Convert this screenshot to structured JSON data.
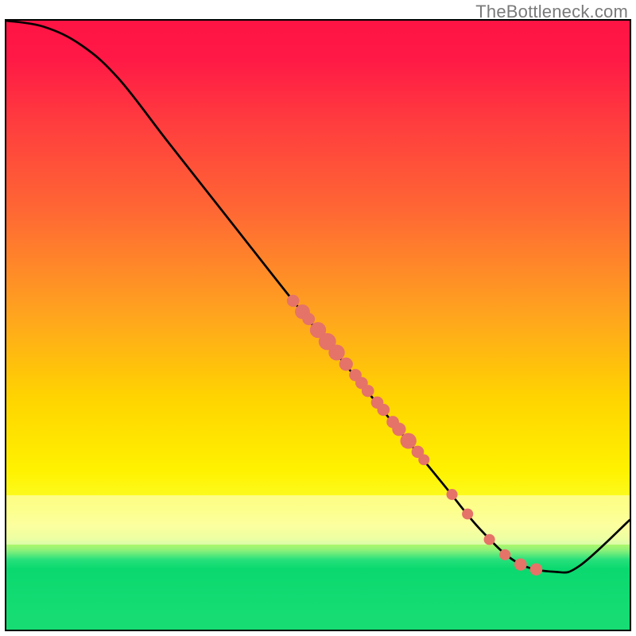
{
  "watermark": "TheBottleneck.com",
  "chart_data": {
    "type": "line",
    "title": "",
    "xlabel": "",
    "ylabel": "",
    "xlim": [
      0,
      100
    ],
    "ylim": [
      0,
      100
    ],
    "highlight_band_y": [
      14,
      22
    ],
    "curve": [
      {
        "x": 0,
        "y": 100
      },
      {
        "x": 6,
        "y": 99
      },
      {
        "x": 12,
        "y": 96
      },
      {
        "x": 18,
        "y": 90.5
      },
      {
        "x": 26,
        "y": 80
      },
      {
        "x": 36,
        "y": 67
      },
      {
        "x": 46,
        "y": 54
      },
      {
        "x": 54,
        "y": 44
      },
      {
        "x": 62,
        "y": 34
      },
      {
        "x": 70,
        "y": 24
      },
      {
        "x": 76,
        "y": 16.5
      },
      {
        "x": 82,
        "y": 11
      },
      {
        "x": 88,
        "y": 9.5
      },
      {
        "x": 92,
        "y": 10.5
      },
      {
        "x": 100,
        "y": 18
      }
    ],
    "markers": [
      {
        "x": 46,
        "y": 54,
        "r": 1.0
      },
      {
        "x": 47.5,
        "y": 52.2,
        "r": 1.2
      },
      {
        "x": 48.5,
        "y": 51.0,
        "r": 1.0
      },
      {
        "x": 50,
        "y": 49.2,
        "r": 1.3
      },
      {
        "x": 51.5,
        "y": 47.3,
        "r": 1.4
      },
      {
        "x": 53,
        "y": 45.5,
        "r": 1.3
      },
      {
        "x": 54.5,
        "y": 43.6,
        "r": 1.1
      },
      {
        "x": 56,
        "y": 41.8,
        "r": 1.0
      },
      {
        "x": 57,
        "y": 40.5,
        "r": 1.0
      },
      {
        "x": 58,
        "y": 39.2,
        "r": 1.0
      },
      {
        "x": 59.5,
        "y": 37.3,
        "r": 1.0
      },
      {
        "x": 60.5,
        "y": 36.1,
        "r": 1.0
      },
      {
        "x": 62,
        "y": 34.1,
        "r": 1.0
      },
      {
        "x": 63,
        "y": 32.9,
        "r": 1.1
      },
      {
        "x": 64.5,
        "y": 31.0,
        "r": 1.3
      },
      {
        "x": 66,
        "y": 29.2,
        "r": 1.0
      },
      {
        "x": 67,
        "y": 27.9,
        "r": 0.9
      },
      {
        "x": 71.5,
        "y": 22.2,
        "r": 0.9
      },
      {
        "x": 74,
        "y": 19.0,
        "r": 0.9
      },
      {
        "x": 77.5,
        "y": 14.8,
        "r": 0.9
      },
      {
        "x": 80,
        "y": 12.3,
        "r": 0.9
      },
      {
        "x": 82.5,
        "y": 10.7,
        "r": 1.0
      },
      {
        "x": 85,
        "y": 9.9,
        "r": 1.0
      }
    ],
    "colors": {
      "curve": "#000000",
      "marker": "#e57368"
    }
  }
}
